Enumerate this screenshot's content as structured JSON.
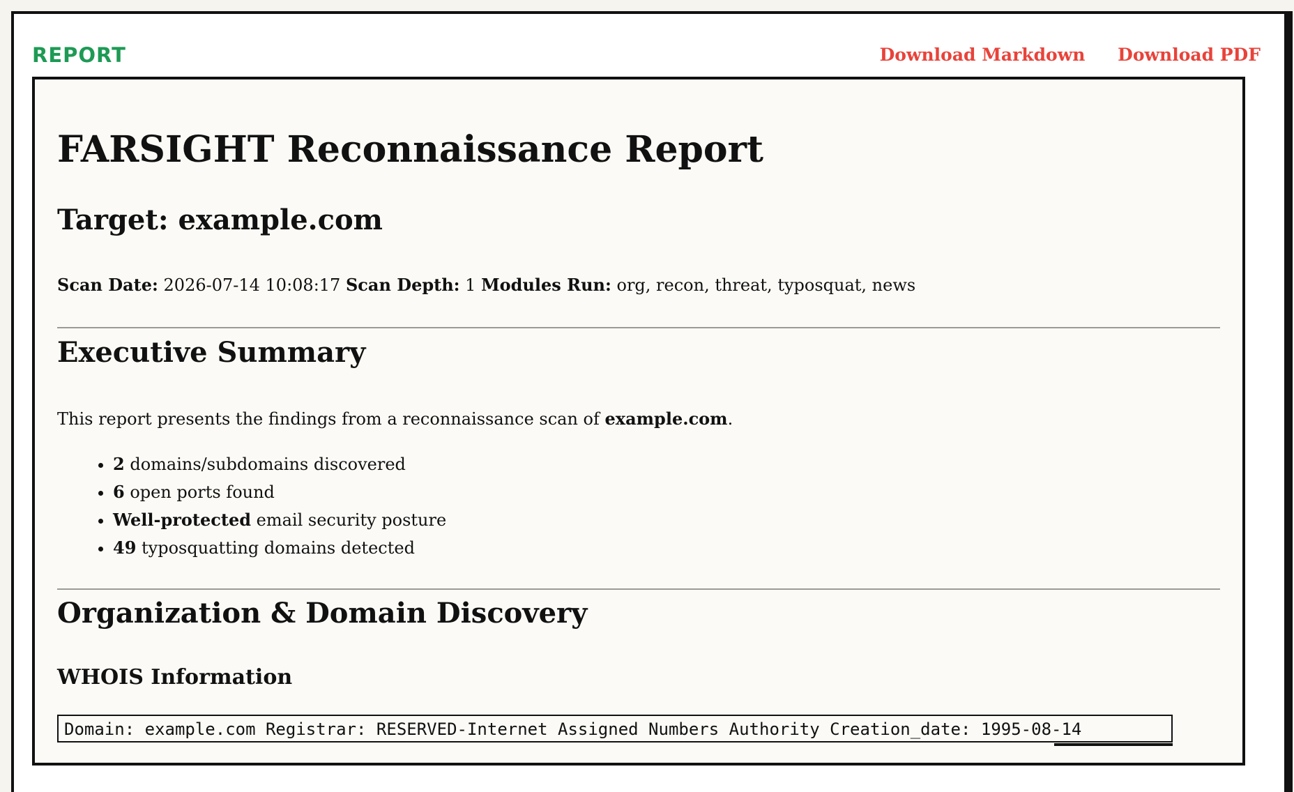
{
  "header": {
    "brand": "REPORT",
    "download_markdown": "Download Markdown",
    "download_pdf": "Download PDF"
  },
  "report": {
    "title": "FARSIGHT Reconnaissance Report",
    "target": "Target: example.com",
    "meta": {
      "scan_date_label": "Scan Date:",
      "scan_date_value": "2026-07-14 10:08:17",
      "scan_depth_label": "Scan Depth:",
      "scan_depth_value": "1",
      "modules_label": "Modules Run:",
      "modules_value": "org, recon, threat, typosquat, news"
    },
    "executive_summary": {
      "heading": "Executive Summary",
      "intro_prefix": "This report presents the findings from a reconnaissance scan of ",
      "intro_target": "example.com",
      "intro_suffix": ".",
      "bullets": [
        {
          "strong": "2",
          "text": " domains/subdomains discovered"
        },
        {
          "strong": "6",
          "text": " open ports found"
        },
        {
          "strong": "Well-protected",
          "text": " email security posture"
        },
        {
          "strong": "49",
          "text": " typosquatting domains detected"
        }
      ]
    },
    "org_discovery": {
      "heading": "Organization & Domain Discovery",
      "whois_heading": "WHOIS Information",
      "whois_text": "Domain: example.com Registrar: RESERVED-Internet Assigned Numbers Authority Creation_date: 1995-08-14"
    }
  }
}
